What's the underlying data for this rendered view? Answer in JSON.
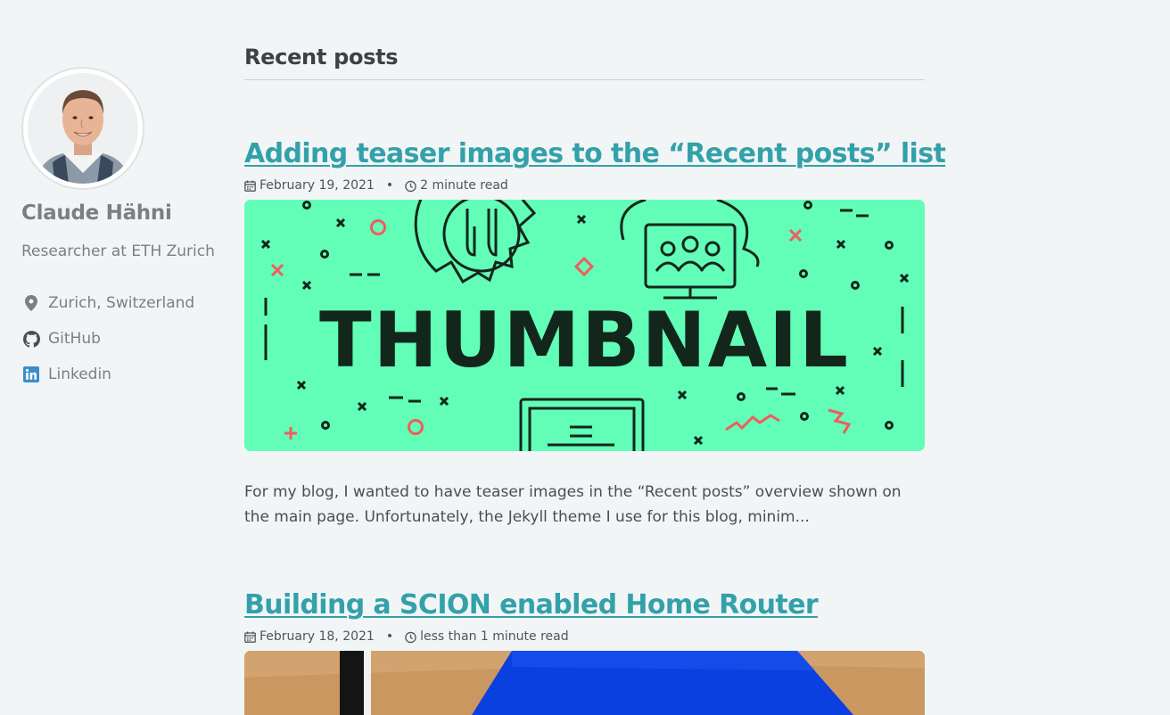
{
  "author": {
    "name": "Claude Hähni",
    "bio": "Researcher at ETH Zurich",
    "links": [
      {
        "label": "Zurich, Switzerland",
        "icon": "map-marker-icon"
      },
      {
        "label": "GitHub",
        "icon": "github-icon"
      },
      {
        "label": "Linkedin",
        "icon": "linkedin-icon"
      }
    ]
  },
  "main": {
    "section_title": "Recent posts",
    "posts": [
      {
        "title": "Adding teaser images to the “Recent posts” list",
        "date": "February 19, 2021",
        "read_time": "2 minute read",
        "teaser_text": "THUMBNAIL",
        "excerpt": "For my blog, I wanted to have teaser images in the “Recent posts” overview shown on the main page. Unfortunately, the Jekyll theme I use for this blog, minim..."
      },
      {
        "title": "Building a SCION enabled Home Router",
        "date": "February 18, 2021",
        "read_time": "less than 1 minute read"
      }
    ],
    "separator": "•"
  },
  "colors": {
    "background": "#f2f5f6",
    "link": "#33a1aa",
    "teaser_green": "#62fdb7",
    "linkedin_blue": "#3b8ecb"
  }
}
